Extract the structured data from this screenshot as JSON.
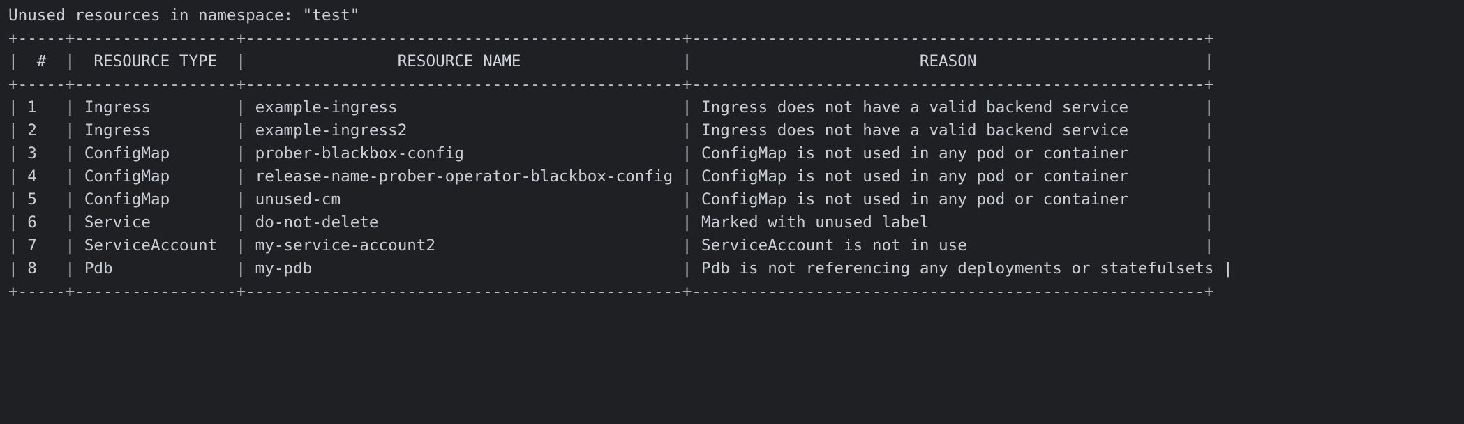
{
  "terminal": {
    "background_color": "#1e2024",
    "text_color": "#c9ced5",
    "title_line": "Unused resources in namespace: \"test\"",
    "namespace": "test"
  },
  "table": {
    "columns": [
      {
        "key": "index",
        "header": "#",
        "width": 3,
        "align": "center"
      },
      {
        "key": "resource_type",
        "header": "RESOURCE TYPE",
        "width": 15,
        "align": "center"
      },
      {
        "key": "resource_name",
        "header": "RESOURCE NAME",
        "width": 44,
        "align": "center"
      },
      {
        "key": "reason",
        "header": "REASON",
        "width": 52,
        "align": "center"
      }
    ],
    "rows": [
      {
        "index": "1",
        "resource_type": "Ingress",
        "resource_name": "example-ingress",
        "reason": "Ingress does not have a valid backend service"
      },
      {
        "index": "2",
        "resource_type": "Ingress",
        "resource_name": "example-ingress2",
        "reason": "Ingress does not have a valid backend service"
      },
      {
        "index": "3",
        "resource_type": "ConfigMap",
        "resource_name": "prober-blackbox-config",
        "reason": "ConfigMap is not used in any pod or container"
      },
      {
        "index": "4",
        "resource_type": "ConfigMap",
        "resource_name": "release-name-prober-operator-blackbox-config",
        "reason": "ConfigMap is not used in any pod or container"
      },
      {
        "index": "5",
        "resource_type": "ConfigMap",
        "resource_name": "unused-cm",
        "reason": "ConfigMap is not used in any pod or container"
      },
      {
        "index": "6",
        "resource_type": "Service",
        "resource_name": "do-not-delete",
        "reason": "Marked with unused label"
      },
      {
        "index": "7",
        "resource_type": "ServiceAccount",
        "resource_name": "my-service-account2",
        "reason": "ServiceAccount is not in use"
      },
      {
        "index": "8",
        "resource_type": "Pdb",
        "resource_name": "my-pdb",
        "reason": "Pdb is not referencing any deployments or statefulsets"
      }
    ]
  }
}
